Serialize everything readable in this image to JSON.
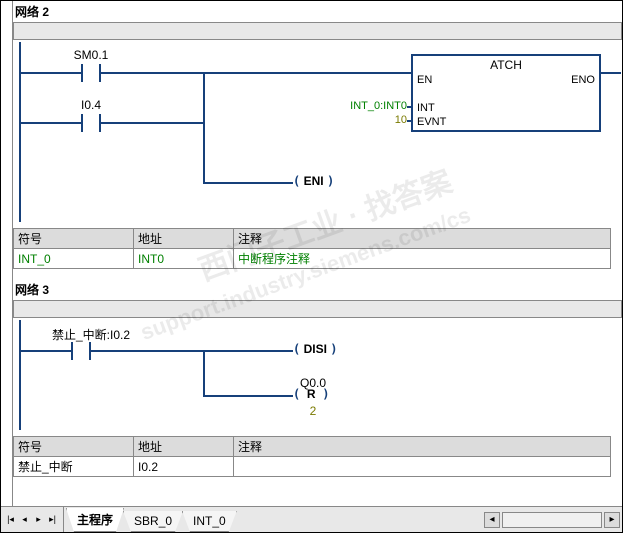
{
  "networks": {
    "n2": {
      "title": "网络 2",
      "contacts": {
        "c1": "SM0.1",
        "c2": "I0.4"
      },
      "coil_eni": "ENI",
      "box": {
        "title": "ATCH",
        "pin_en": "EN",
        "pin_eno": "ENO",
        "pin_int": "INT",
        "pin_evnt": "EVNT",
        "val_int": "INT_0:INT0",
        "val_evnt": "10"
      }
    },
    "n3": {
      "title": "网络 3",
      "contact": "禁止_中断:I0.2",
      "coil_disi": "DISI",
      "output_addr": "Q0.0",
      "coil_r": "R",
      "r_count": "2"
    }
  },
  "sym_table": {
    "headers": {
      "sym": "符号",
      "addr": "地址",
      "comment": "注释"
    },
    "rows_n2": [
      {
        "sym": "INT_0",
        "addr": "INT0",
        "comment": "中断程序注释"
      }
    ],
    "rows_n3": [
      {
        "sym": "禁止_中断",
        "addr": "I0.2",
        "comment": ""
      }
    ]
  },
  "tabs": {
    "t1": "主程序",
    "t2": "SBR_0",
    "t3": "INT_0"
  },
  "watermark": {
    "line1": "西门子工业 · 找答案",
    "line2": "support.industry.siemens.com/cs"
  }
}
